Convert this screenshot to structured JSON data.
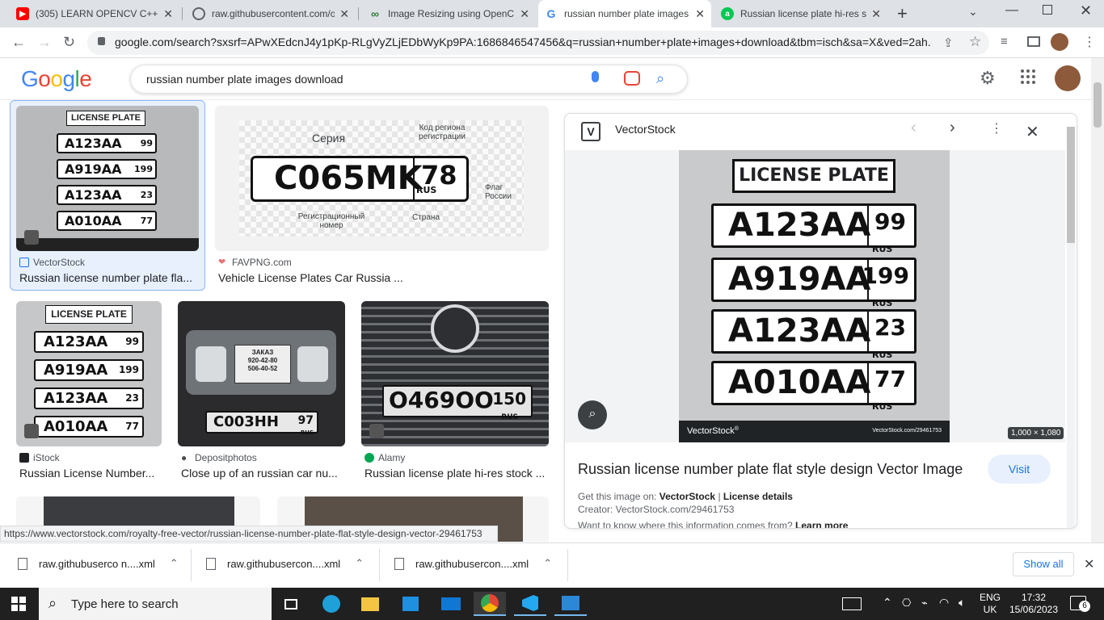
{
  "tabs": [
    {
      "title": "(305) LEARN OPENCV C++ in",
      "icon": "youtube-icon",
      "color": "#ff0000"
    },
    {
      "title": "raw.githubusercontent.com/o",
      "icon": "globe-icon",
      "color": "#5f6368"
    },
    {
      "title": "Image Resizing using OpenC",
      "icon": "link-icon",
      "color": "#2e7d32"
    },
    {
      "title": "russian number plate images",
      "icon": "google-icon",
      "color": "#4285f4"
    },
    {
      "title": "Russian license plate hi-res st",
      "icon": "alamy-icon",
      "color": "#00c853"
    }
  ],
  "address": {
    "url": "google.com/search?sxsrf=APwXEdcnJ4y1pKp-RLgVyZLjEDbWyKp9PA:1686846547456&q=russian+number+plate+images+download&tbm=isch&sa=X&ved=2ah..."
  },
  "search": {
    "logo": "Google",
    "query": "russian number plate images download"
  },
  "results": [
    {
      "source": "VectorStock",
      "caption": "Russian license number plate fla...",
      "src_color": "#1a73e8"
    },
    {
      "source": "FAVPNG.com",
      "caption": "Vehicle License Plates Car Russia ...",
      "src_color": "#e57373"
    },
    {
      "source": "iStock",
      "caption": "Russian License Number...",
      "src_color": "#202124"
    },
    {
      "source": "Depositphotos",
      "caption": "Close up of an russian car nu...",
      "src_color": "#202124"
    },
    {
      "source": "Alamy",
      "caption": "Russian license plate hi-res stock ...",
      "src_color": "#00a651"
    }
  ],
  "image_text": {
    "header": "LICENSE PLATE",
    "plates": [
      {
        "num": "A123AA",
        "region": "99"
      },
      {
        "num": "A919AA",
        "region": "199"
      },
      {
        "num": "A123AA",
        "region": "23"
      },
      {
        "num": "A010AA",
        "region": "77"
      }
    ],
    "rus": "RUS",
    "vs_brand": "VectorStock",
    "vs_brand_mark": "®",
    "vs_url": "VectorStock.com/29461753",
    "favpng": {
      "plate_num": "C065MK",
      "region": "78",
      "rus": "RUS",
      "seriya": "Серия",
      "kod": "Код региона регистрации",
      "flag": "Флаг России",
      "reg": "Регистрационный номер",
      "strana": "Страна"
    },
    "depo": {
      "zakaz": "ЗАКАЗ",
      "phone1": "920-42-80",
      "phone2": "506-40-52",
      "plate": "C003HH",
      "region": "97",
      "rus": "RUS"
    },
    "alamy": {
      "plate": "O469OO",
      "region": "150",
      "rus": "RUS"
    }
  },
  "panel": {
    "source": "VectorStock",
    "dimensions": "1,000 × 1,080",
    "title": "Russian license number plate flat style design Vector Image",
    "visit": "Visit",
    "get_label": "Get this image on:",
    "get_source": "VectorStock",
    "get_sep": "|",
    "license": "License details",
    "creator": "Creator: VectorStock.com/29461753",
    "want": "Want to know where this information comes from?",
    "learn": "Learn more"
  },
  "status_url": "https://www.vectorstock.com/royalty-free-vector/russian-license-number-plate-flat-style-design-vector-29461753",
  "downloads": [
    {
      "name": "raw.githubuserco n....xml"
    },
    {
      "name": "raw.githubusercon....xml"
    },
    {
      "name": "raw.githubusercon....xml"
    }
  ],
  "show_all": "Show all",
  "taskbar": {
    "search_placeholder": "Type here to search",
    "lang1": "ENG",
    "lang2": "UK",
    "time": "17:32",
    "date": "15/06/2023",
    "notif": "6"
  }
}
